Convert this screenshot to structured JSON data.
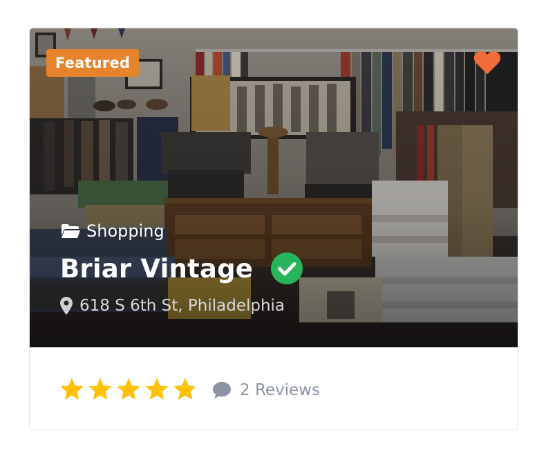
{
  "listing": {
    "badge": "Featured",
    "favorite_icon": "heart-icon",
    "favorite_color": "#f26b3a",
    "category": "Shopping",
    "category_icon": "folder-open-icon",
    "title": "Briar Vintage",
    "verified_icon": "check-circle-icon",
    "verified_color": "#28b45a",
    "address": "618 S 6th St, Philadelphia",
    "address_icon": "map-pin-icon",
    "rating": 4.9,
    "rating_max": 5,
    "star_color": "#ffc107",
    "reviews_icon": "comment-icon",
    "reviews_label": "2 Reviews",
    "badge_color": "#e6842d"
  }
}
